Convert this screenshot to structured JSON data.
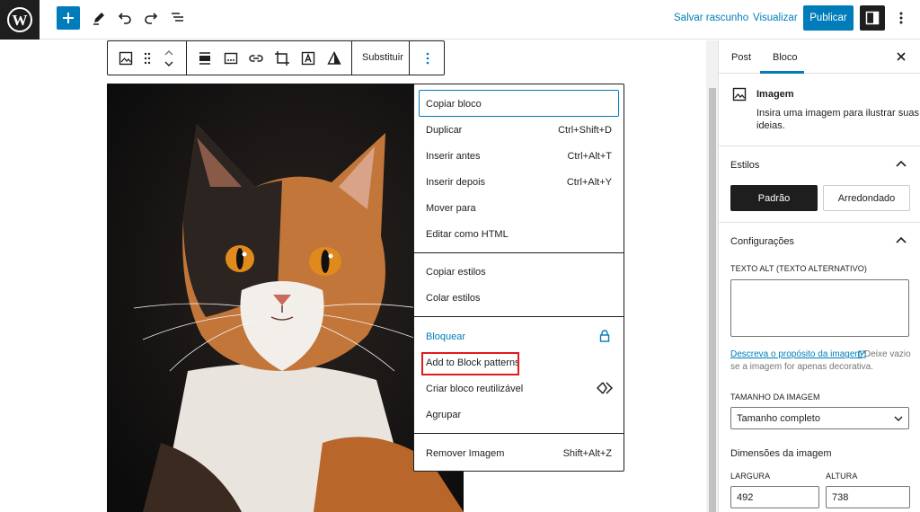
{
  "topbar": {
    "save_draft": "Salvar rascunho",
    "preview": "Visualizar",
    "publish": "Publicar"
  },
  "block_toolbar": {
    "replace": "Substituir"
  },
  "menu": {
    "copy_block": "Copiar bloco",
    "duplicate": "Duplicar",
    "duplicate_shortcut": "Ctrl+Shift+D",
    "insert_before": "Inserir antes",
    "insert_before_shortcut": "Ctrl+Alt+T",
    "insert_after": "Inserir depois",
    "insert_after_shortcut": "Ctrl+Alt+Y",
    "move_to": "Mover para",
    "edit_html": "Editar como HTML",
    "copy_styles": "Copiar estilos",
    "paste_styles": "Colar estilos",
    "lock": "Bloquear",
    "add_pattern": "Add to Block patterns",
    "create_reusable": "Criar bloco reutilizável",
    "group": "Agrupar",
    "remove": "Remover Imagem",
    "remove_shortcut": "Shift+Alt+Z"
  },
  "sidebar": {
    "tab_post": "Post",
    "tab_block": "Bloco",
    "block_name": "Imagem",
    "block_desc_1": "Insira uma imagem para ilustrar suas",
    "block_desc_2": "ideias.",
    "styles_title": "Estilos",
    "style_default": "Padrão",
    "style_rounded": "Arredondado",
    "settings_title": "Configurações",
    "alt_label": "TEXTO ALT (TEXTO ALTERNATIVO)",
    "alt_link": "Descreva o propósito da imagem",
    "alt_help_1": " Deixe vazio",
    "alt_help_2": "se a imagem for apenas decorativa.",
    "size_label": "TAMANHO DA IMAGEM",
    "size_value": "Tamanho completo",
    "dims_title": "Dimensões da imagem",
    "width_label": "LARGURA",
    "height_label": "ALTURA",
    "width_value": "492",
    "height_value": "738"
  }
}
